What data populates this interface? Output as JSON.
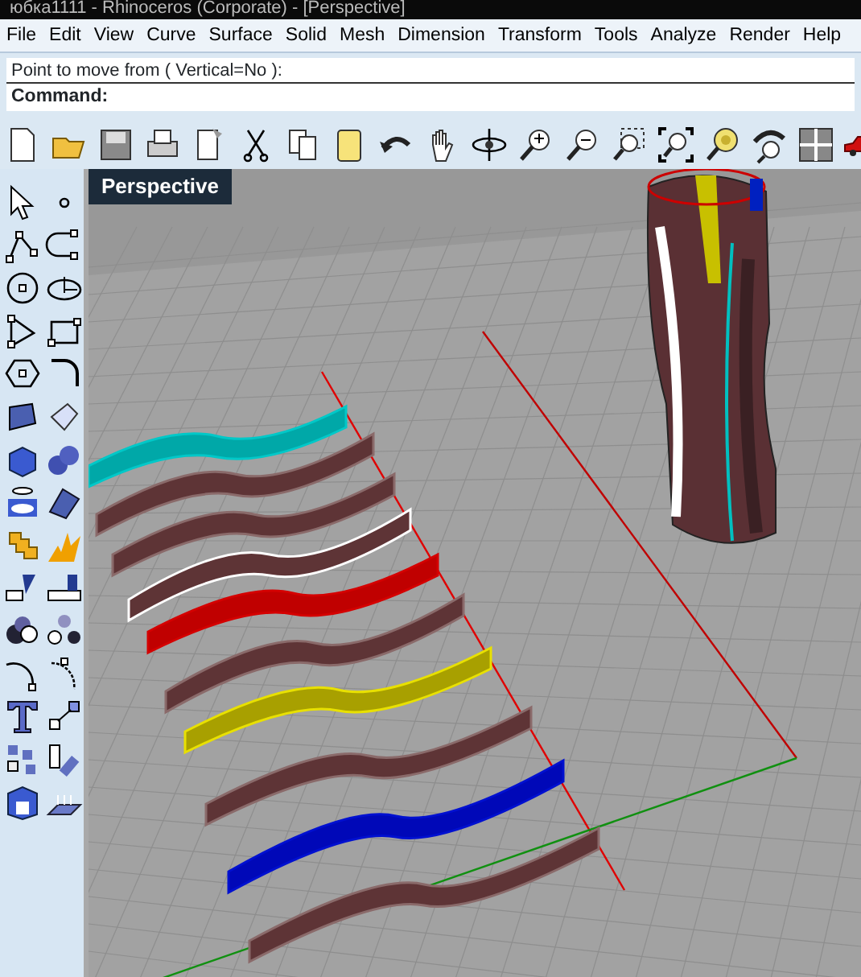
{
  "window": {
    "title": "юбка1111 - Rhinoceros (Corporate) - [Perspective]"
  },
  "menu": [
    {
      "label": "File"
    },
    {
      "label": "Edit"
    },
    {
      "label": "View"
    },
    {
      "label": "Curve"
    },
    {
      "label": "Surface"
    },
    {
      "label": "Solid"
    },
    {
      "label": "Mesh"
    },
    {
      "label": "Dimension"
    },
    {
      "label": "Transform"
    },
    {
      "label": "Tools"
    },
    {
      "label": "Analyze"
    },
    {
      "label": "Render"
    },
    {
      "label": "Help"
    }
  ],
  "command": {
    "history": "Point to move from ( Vertical=No ):",
    "prompt": "Command:"
  },
  "viewport": {
    "label": "Perspective",
    "strips": [
      {
        "color": "#00c8c8"
      },
      {
        "color": "#5e3436"
      },
      {
        "color": "#5e3436"
      },
      {
        "color": "#ffffff"
      },
      {
        "color": "#d40000"
      },
      {
        "color": "#5e3436"
      },
      {
        "color": "#e8e000"
      },
      {
        "color": "#5e3436"
      },
      {
        "color": "#0010d0"
      },
      {
        "color": "#5e3436"
      }
    ]
  }
}
